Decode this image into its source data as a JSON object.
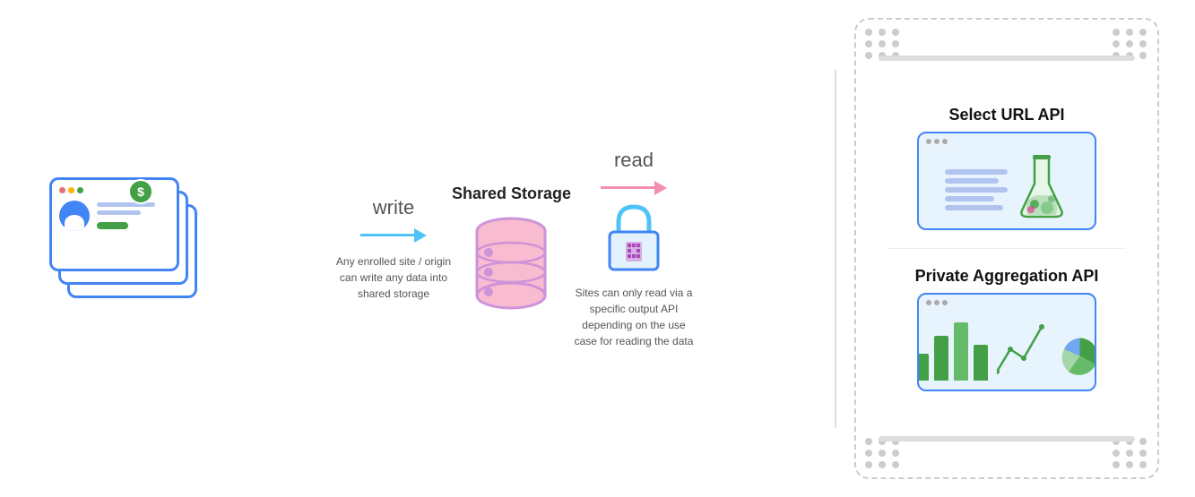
{
  "diagram": {
    "write_label": "write",
    "write_desc": "Any enrolled site / origin can write any data into shared storage",
    "read_label": "read",
    "read_desc": "Sites can only read via a specific output API depending on the use case for reading the data",
    "database_title": "Shared Storage",
    "api_section_title": "",
    "apis": [
      {
        "id": "select-url",
        "title": "Select URL API"
      },
      {
        "id": "private-aggregation",
        "title": "Private Aggregation API"
      }
    ]
  },
  "colors": {
    "blue": "#4285f4",
    "light_blue": "#4fc3f7",
    "pink": "#e91e8c",
    "light_pink": "#f48fb1",
    "purple": "#ab47bc",
    "green": "#43a047",
    "gray_border": "#cccccc",
    "gray_dot": "#cccccc",
    "text_dark": "#111111",
    "text_mid": "#555555"
  }
}
